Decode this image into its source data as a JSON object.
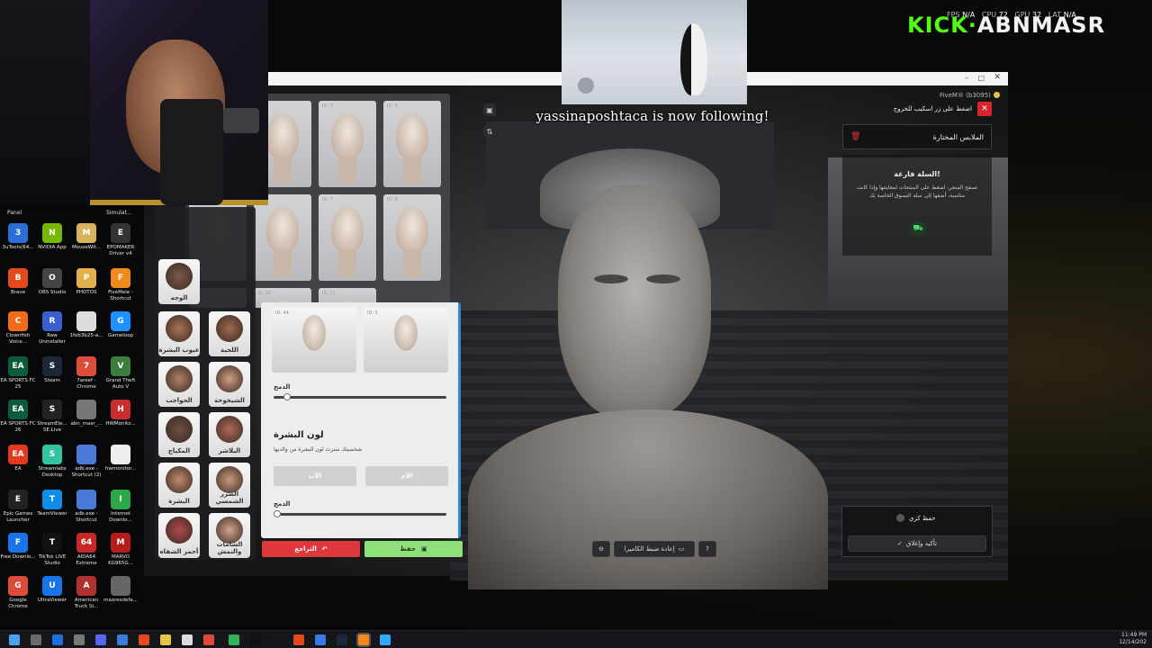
{
  "overlay": {
    "brand_kick": "KICK",
    "brand_name": "ABNMASR",
    "stats": {
      "fps_label": "FPS",
      "fps": "N/A",
      "cpu_label": "CPU",
      "cpu": "72",
      "gpu_label": "GPU",
      "gpu": "32",
      "lat_label": "LAT",
      "lat": "N/A"
    },
    "follow_alert": "yassinaposhtaca is now following!"
  },
  "desktop": {
    "top_labels": [
      "Panel",
      "Simulat..."
    ],
    "icons": [
      {
        "label": "3uTools(64...",
        "color": "#2a6fd6",
        "glyph": "3"
      },
      {
        "label": "NVIDIA App",
        "color": "#76b900",
        "glyph": "N"
      },
      {
        "label": "MouseWit...",
        "color": "#d8b35c",
        "glyph": "M"
      },
      {
        "label": "EPOMAKER Driver v4",
        "color": "#333",
        "glyph": "E"
      },
      {
        "label": "Brave",
        "color": "#e24a1b",
        "glyph": "B"
      },
      {
        "label": "OBS Studio",
        "color": "#444",
        "glyph": "O"
      },
      {
        "label": "PHOTOS",
        "color": "#e0b04a",
        "glyph": "P"
      },
      {
        "label": "FiveMeie - Shortcut",
        "color": "#f08a1a",
        "glyph": "F"
      },
      {
        "label": "Clownfish Voice...",
        "color": "#f06a1a",
        "glyph": "C"
      },
      {
        "label": "Raw Uninstaller",
        "color": "#3a5fcf",
        "glyph": "R"
      },
      {
        "label": "1feb3b25-a...",
        "color": "#ddd",
        "glyph": ""
      },
      {
        "label": "Gameloop",
        "color": "#1e90ff",
        "glyph": "G"
      },
      {
        "label": "EA SPORTS FC 25",
        "color": "#0c5c3a",
        "glyph": "EA"
      },
      {
        "label": "Steam",
        "color": "#1b2838",
        "glyph": "S"
      },
      {
        "label": "7areef - Chrome",
        "color": "#dd4b39",
        "glyph": "7"
      },
      {
        "label": "Grand Theft Auto V",
        "color": "#3b7d3b",
        "glyph": "V"
      },
      {
        "label": "EA SPORTS FC 26",
        "color": "#0c5c3a",
        "glyph": "EA"
      },
      {
        "label": "StreamEle... SE.Live",
        "color": "#222",
        "glyph": "S"
      },
      {
        "label": "abn_masr_...",
        "color": "#777",
        "glyph": ""
      },
      {
        "label": "HWMonito...",
        "color": "#c92d2d",
        "glyph": "H"
      },
      {
        "label": "EA",
        "color": "#e2391f",
        "glyph": "EA"
      },
      {
        "label": "Streamlabs Desktop",
        "color": "#31c3a2",
        "glyph": "S"
      },
      {
        "label": "adb.exe - Shortcut (2)",
        "color": "#4a7ad8",
        "glyph": ""
      },
      {
        "label": "hwmonitor...",
        "color": "#eee",
        "glyph": ""
      },
      {
        "label": "Epic Games Launcher",
        "color": "#222",
        "glyph": "E"
      },
      {
        "label": "TeamViewer",
        "color": "#0e8ee9",
        "glyph": "T"
      },
      {
        "label": "adb.exe - Shortcut",
        "color": "#4a7ad8",
        "glyph": ""
      },
      {
        "label": "Internet Downlo...",
        "color": "#2aa84a",
        "glyph": "I"
      },
      {
        "label": "Free Downlo...",
        "color": "#1a73e8",
        "glyph": "F"
      },
      {
        "label": "TikTok LIVE Studio",
        "color": "#111",
        "glyph": "T"
      },
      {
        "label": "AIDA64 Extreme",
        "color": "#c62828",
        "glyph": "64"
      },
      {
        "label": "MARVO KG965G...",
        "color": "#b71c1c",
        "glyph": "M"
      },
      {
        "label": "Google Chrome",
        "color": "#dd4b39",
        "glyph": "G"
      },
      {
        "label": "UltraViewer",
        "color": "#1a73e8",
        "glyph": "U"
      },
      {
        "label": "American Truck Si...",
        "color": "#b03030",
        "glyph": "A"
      },
      {
        "label": "maxresdefa...",
        "color": "#666",
        "glyph": ""
      },
      {
        "label": "zxvascx.jpg",
        "color": "#666",
        "glyph": ""
      },
      {
        "label": "ج‍ن‍شين...",
        "color": "#666",
        "glyph": ""
      }
    ]
  },
  "game": {
    "window_title": "FiveM® (b3095)",
    "exit_hint": "اضغط على زر اسكيب للخروج",
    "selected_clothes": "الملابس المختارة",
    "cart_empty_title": "السلة فارغة!",
    "cart_empty_text": "تصفح المتجر، اضغط على المنتجات لمعاينتها وإذا كانت مناسبة، أضفها إلى سلة التسوق الخاصة بك",
    "save_outfit": "حفظ كزي",
    "confirm_close": "تأكيد وإغلاق",
    "reset_camera": "إعادة ضبط الكاميرا",
    "editor": {
      "face_ids": [
        "ID: 1",
        "ID: 2",
        "ID: 3",
        "ID: 4",
        "ID: 5",
        "ID: 6",
        "ID: 7",
        "ID: 8",
        "ID: 9",
        "ID: 10",
        "ID: 11"
      ],
      "small_face_ids": [
        "ID: 44",
        "ID: 5"
      ],
      "categories": [
        {
          "label": "الوجه"
        },
        {
          "label": "عيوب البشرة"
        },
        {
          "label": "اللحية"
        },
        {
          "label": "الحواجب"
        },
        {
          "label": "الشيخوخة"
        },
        {
          "label": "المكياج"
        },
        {
          "label": "البلاشر"
        },
        {
          "label": "البشرة"
        },
        {
          "label": "الضرر الشمسي"
        },
        {
          "label": "أحمر الشفاه"
        },
        {
          "label": "الشامات والنمش"
        }
      ],
      "blend_label_1": "الدمج",
      "blend_value_1": 0.08,
      "skin_color_title": "لون البشرة",
      "skin_color_desc": "شخصيتك سترث لون البشرة من والديها",
      "father": "الأب",
      "mother": "الأم",
      "blend_label_2": "الدمج",
      "blend_value_2": 0.02,
      "undo": "التراجع",
      "save": "حفظ"
    }
  },
  "taskbar": {
    "time": "11:49 PM",
    "date": "12/14/202"
  }
}
